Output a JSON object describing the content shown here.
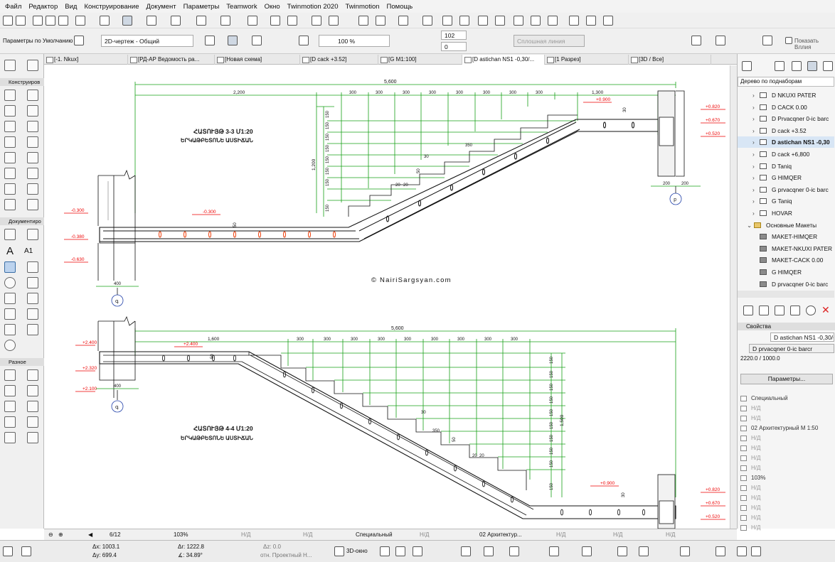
{
  "menu": [
    "Файл",
    "Редактор",
    "Вид",
    "Конструирование",
    "Документ",
    "Параметры",
    "Teamwork",
    "Окно",
    "Twinmotion 2020",
    "Twinmotion",
    "Помощь"
  ],
  "toolbar2": {
    "defaults_label": "Параметры по Умолчанию",
    "view_mode": "2D-чертеж - Общий",
    "percent": "100 %",
    "val1": "102",
    "val2": "0",
    "line_type": "Сплошная линия",
    "show_all": "Показать Вллия"
  },
  "tabs": [
    "[-1. Nkux]",
    "[РД-АР Ведомость ра...",
    "[Новая схема]",
    "[D cack +3.52]",
    "[G M1:100]",
    "[D astichan NS1 -0,30/...",
    "[1 Разрез]",
    "[3D / Все]"
  ],
  "toolbox": {
    "sec_design": "Конструиров",
    "sec_doc": "Документиро",
    "sec_misc": "Разное",
    "label_a1": "A1"
  },
  "tree": {
    "header": "Дерево по поднаборам",
    "items": [
      {
        "label": "D NKUXI PATER",
        "type": "view"
      },
      {
        "label": "D CACK 0.00",
        "type": "view"
      },
      {
        "label": "D Prvacqner 0-ic barc",
        "type": "view"
      },
      {
        "label": "D cack +3.52",
        "type": "view"
      },
      {
        "label": "D astichan NS1 -0,30",
        "type": "view",
        "selected": true
      },
      {
        "label": "D cack +6,800",
        "type": "view"
      },
      {
        "label": "D Taniq",
        "type": "view"
      },
      {
        "label": "G HIMQER",
        "type": "view"
      },
      {
        "label": "G prvacqner 0-ic barc",
        "type": "view"
      },
      {
        "label": "G Taniq",
        "type": "view"
      },
      {
        "label": "HOVAR",
        "type": "view"
      },
      {
        "label": "Основные Макеты",
        "type": "folder"
      },
      {
        "label": "MAKET-HIMQER",
        "type": "layout"
      },
      {
        "label": "MAKET-NKUXI PATER",
        "type": "layout"
      },
      {
        "label": "MAKET-CACK 0.00",
        "type": "layout"
      },
      {
        "label": "G HIMQER",
        "type": "layout"
      },
      {
        "label": "D prvacqner 0-ic barc",
        "type": "layout"
      }
    ]
  },
  "properties": {
    "header": "Свойства",
    "name_value": "D astichan NS1 -0,30/+3",
    "layer": "D prvacqner 0-ic barcr",
    "scale": "2220.0 / 1000.0",
    "button": "Параметры...",
    "rows": [
      "Специальный",
      "Н/Д",
      "Н/Д",
      "02 Архитектурный М 1:50",
      "Н/Д",
      "Н/Д",
      "Н/Д",
      "Н/Д",
      "103%",
      "Н/Д",
      "Н/Д",
      "Н/Д",
      "Н/Д",
      "Н/Д"
    ]
  },
  "drawing": {
    "watermark": "© NairiSargsyan.com",
    "title1": "ՀԱՏՈՒՅԹ 3-3 Մ1:20",
    "sub1": "ԵՐԿԱԹԲԵՏՈՆԵ ԱՍՏԻՃԱՆ",
    "title2": "ՀԱՏՈՒՅԹ 4-4 Մ1:20",
    "sub2": "ԵՐԿԱԹԲԵՏՈՆԵ ԱՍՏԻՃԱՆ",
    "dim_total": "5,600",
    "dim_2200": "2,200",
    "dim_1300": "1,300",
    "dim_1600": "1,600",
    "dim_300": "300",
    "dim_150": "150",
    "dim_1200": "1,200",
    "dim_1500": "1,500",
    "dim_350": "350",
    "dim_30": "30",
    "dim_50": "50",
    "dim_20": "20",
    "dim_400": "400",
    "dim_200": "200",
    "lv_m030": "-0.300",
    "lv_m038": "-0.380",
    "lv_m063": "-0.630",
    "lv_p090": "+0.900",
    "lv_p082": "+0.820",
    "lv_p067": "+0.670",
    "lv_p052": "+0.520",
    "lv_p240": "+2.400",
    "lv_p232": "+2.320",
    "lv_p210": "+2.100",
    "axis_q": "գ",
    "axis_b": "բ"
  },
  "statusbar": {
    "page": "6/12",
    "zoom": "103%",
    "nd": "Н/Д",
    "special": "Специальный",
    "arch": "02 Архитектур..."
  },
  "infobar": {
    "dx": "Δx: 1003.1",
    "dy": "Δy: 699.4",
    "da": "Δr: 1222.8",
    "ang": "∡: 34.89°",
    "dz": "Δz: 0.0",
    "ref": "отн. Проектный Н...",
    "view3d": "3D-окно"
  }
}
